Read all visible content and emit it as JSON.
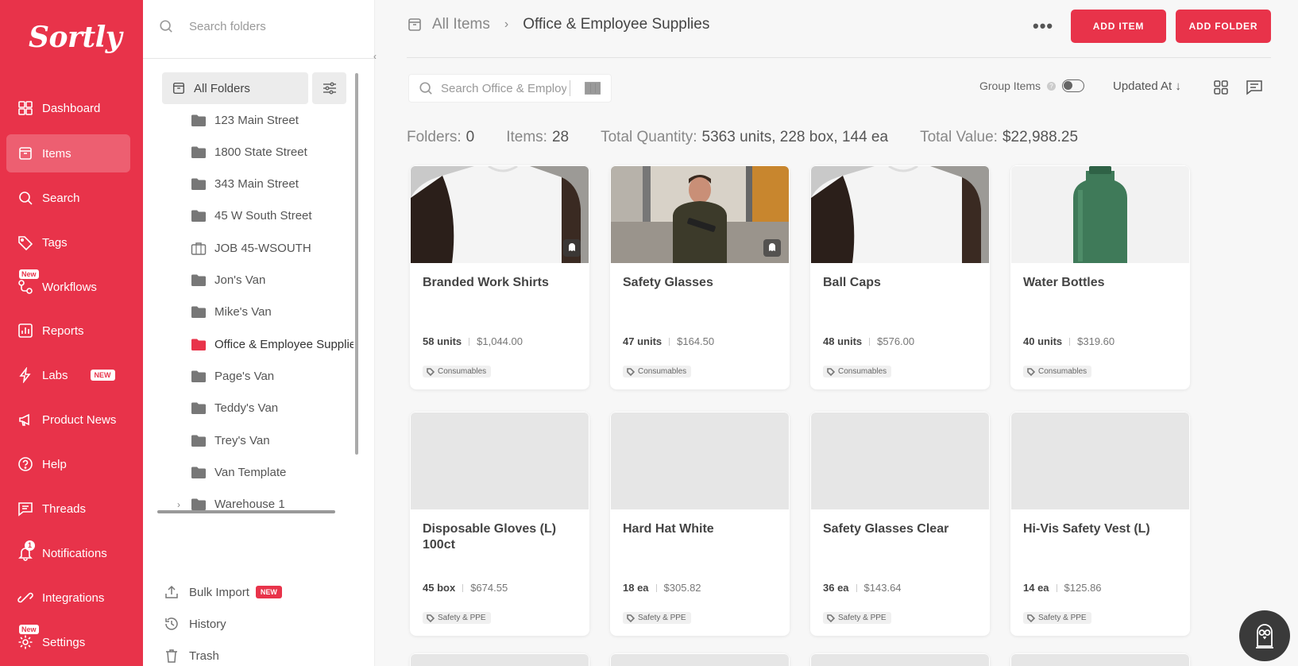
{
  "app": {
    "logo": "Sortly"
  },
  "nav": {
    "items": [
      {
        "label": "Dashboard",
        "icon": "dashboard-icon"
      },
      {
        "label": "Items",
        "icon": "items-icon",
        "active": true
      },
      {
        "label": "Search",
        "icon": "search-icon"
      },
      {
        "label": "Tags",
        "icon": "tag-icon"
      },
      {
        "label": "Workflows",
        "icon": "workflows-icon",
        "badge": "New"
      },
      {
        "label": "Reports",
        "icon": "reports-icon"
      },
      {
        "label": "Labs",
        "icon": "lightning-icon",
        "pill": "NEW"
      },
      {
        "label": "Product News",
        "icon": "megaphone-icon"
      },
      {
        "label": "Help",
        "icon": "help-icon"
      },
      {
        "label": "Threads",
        "icon": "chat-icon"
      },
      {
        "label": "Notifications",
        "icon": "bell-icon",
        "count": "1"
      },
      {
        "label": "Integrations",
        "icon": "integrations-icon"
      },
      {
        "label": "Settings",
        "icon": "gear-icon",
        "badge": "New"
      }
    ]
  },
  "folders": {
    "search_placeholder": "Search folders",
    "all_label": "All Folders",
    "list": [
      {
        "label": "123 Main Street",
        "kind": "folder"
      },
      {
        "label": "1800 State Street",
        "kind": "folder"
      },
      {
        "label": "343 Main Street",
        "kind": "folder"
      },
      {
        "label": "45 W South Street",
        "kind": "folder"
      },
      {
        "label": "JOB 45-WSOUTH",
        "kind": "job"
      },
      {
        "label": "Jon's Van",
        "kind": "folder"
      },
      {
        "label": "Mike's Van",
        "kind": "folder"
      },
      {
        "label": "Office & Employee Supplies",
        "kind": "folder",
        "active": true
      },
      {
        "label": "Page's Van",
        "kind": "folder"
      },
      {
        "label": "Teddy's Van",
        "kind": "folder"
      },
      {
        "label": "Trey's Van",
        "kind": "folder"
      },
      {
        "label": "Van Template",
        "kind": "folder"
      },
      {
        "label": "Warehouse 1",
        "kind": "folder",
        "expandable": true
      }
    ],
    "bottom": {
      "bulk_import": "Bulk Import",
      "bulk_new": "NEW",
      "history": "History",
      "trash": "Trash"
    }
  },
  "header": {
    "breadcrumb_root": "All Items",
    "breadcrumb_sep": "›",
    "breadcrumb_current": "Office & Employee Supplies",
    "more": "•••",
    "add_item": "ADD ITEM",
    "add_folder": "ADD FOLDER"
  },
  "toolbar": {
    "search_placeholder": "Search Office & Employee Supplies",
    "group_items_label": "Group Items",
    "group_items_on": false,
    "sort_label": "Updated At ↓"
  },
  "stats": {
    "folders_label": "Folders:",
    "folders_value": "0",
    "items_label": "Items:",
    "items_value": "28",
    "qty_label": "Total Quantity:",
    "qty_value": "5363 units, 228 box, 144 ea",
    "value_label": "Total Value:",
    "value_value": "$22,988.25"
  },
  "items": [
    {
      "name": "Branded Work Shirts",
      "qty": "58 units",
      "value": "$1,044.00",
      "tag": "Consumables",
      "image": "shirt",
      "badge": true
    },
    {
      "name": "Safety Glasses",
      "qty": "47 units",
      "value": "$164.50",
      "tag": "Consumables",
      "image": "worker",
      "badge": true
    },
    {
      "name": "Ball Caps",
      "qty": "48 units",
      "value": "$576.00",
      "tag": "Consumables",
      "image": "shirt",
      "badge": false
    },
    {
      "name": "Water Bottles",
      "qty": "40 units",
      "value": "$319.60",
      "tag": "Consumables",
      "image": "bottle",
      "badge": false
    },
    {
      "name": "Disposable Gloves (L) 100ct",
      "qty": "45 box",
      "value": "$674.55",
      "tag": "Safety & PPE",
      "image": "none",
      "badge": false
    },
    {
      "name": "Hard Hat White",
      "qty": "18 ea",
      "value": "$305.82",
      "tag": "Safety & PPE",
      "image": "none",
      "badge": false
    },
    {
      "name": "Safety Glasses Clear",
      "qty": "36 ea",
      "value": "$143.64",
      "tag": "Safety & PPE",
      "image": "none",
      "badge": false
    },
    {
      "name": "Hi-Vis Safety Vest (L)",
      "qty": "14 ea",
      "value": "$125.86",
      "tag": "Safety & PPE",
      "image": "none",
      "badge": false
    }
  ],
  "colors": {
    "brand": "#e8334a",
    "active_folder": "#e8334a"
  }
}
